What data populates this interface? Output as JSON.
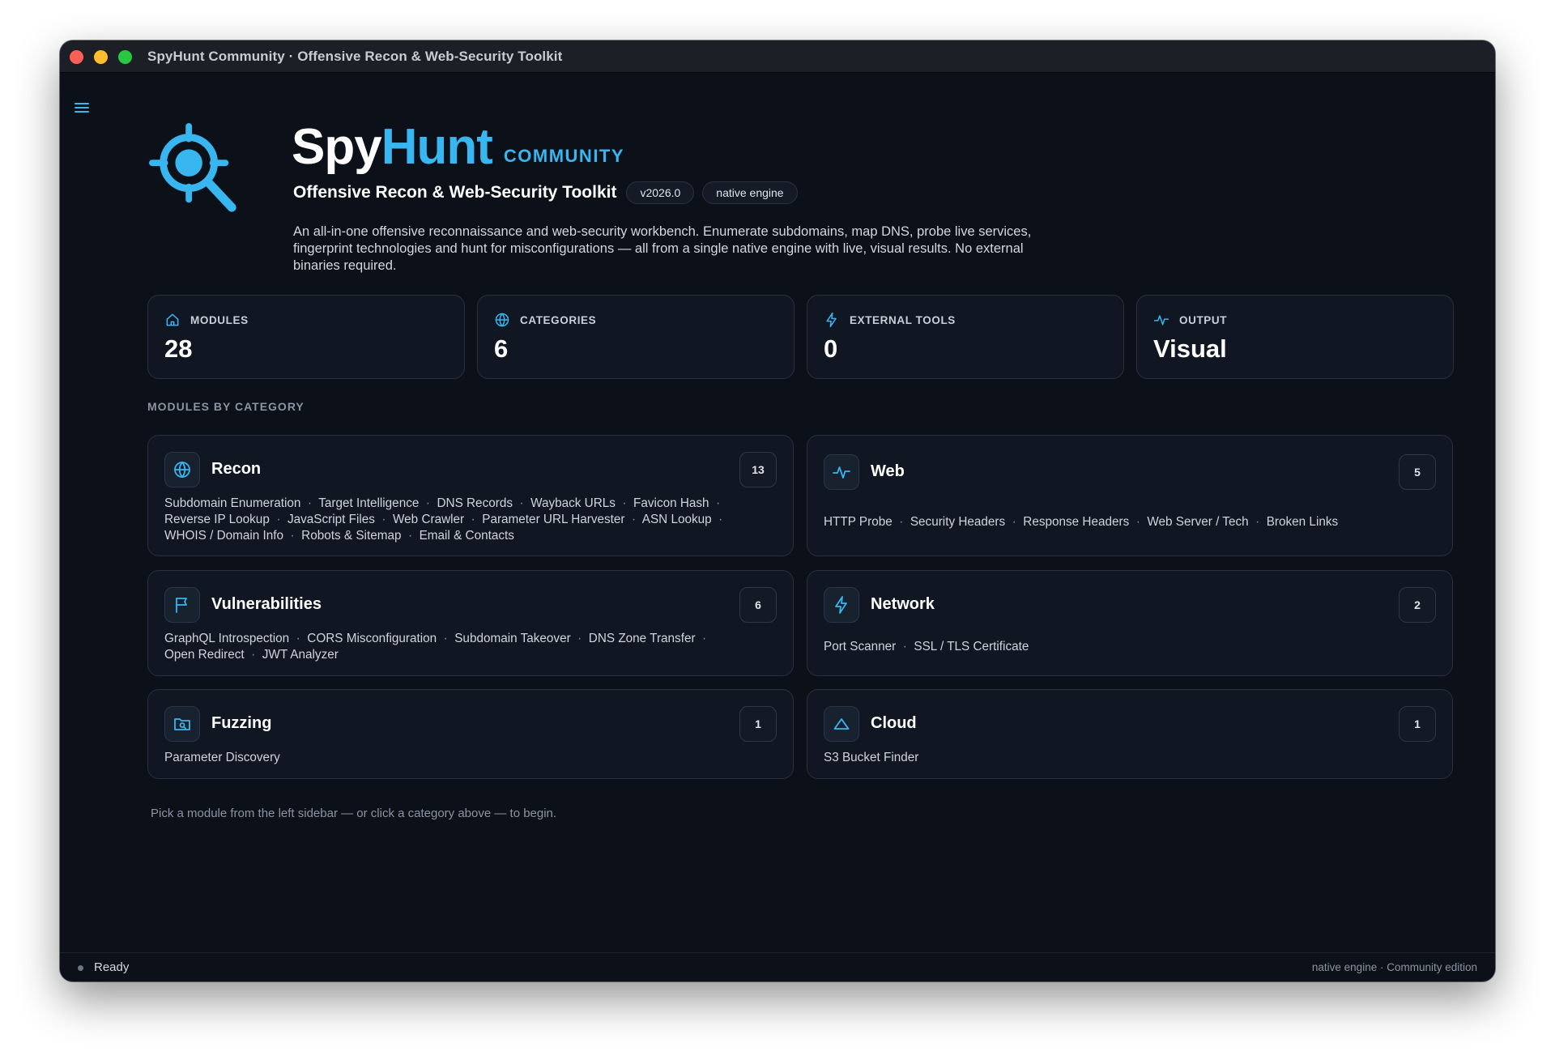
{
  "window": {
    "title": "SpyHunt Community · Offensive Recon & Web-Security Toolkit"
  },
  "header": {
    "brand_part1": "Spy",
    "brand_part2": "Hunt",
    "brand_edition": "COMMUNITY",
    "subtitle": "Offensive Recon & Web-Security Toolkit",
    "version_pill": "v2026.0",
    "engine_pill": "native engine",
    "description": "An all-in-one offensive reconnaissance and web-security workbench. Enumerate subdomains, map DNS, probe live services, fingerprint technologies and hunt for misconfigurations — all from a single native engine with live, visual results. No external binaries required.",
    "logo_icon": "crosshair-magnifier-icon"
  },
  "stats": [
    {
      "label": "MODULES",
      "value": "28",
      "icon": "home-icon"
    },
    {
      "label": "CATEGORIES",
      "value": "6",
      "icon": "globe-icon"
    },
    {
      "label": "EXTERNAL TOOLS",
      "value": "0",
      "icon": "bolt-icon"
    },
    {
      "label": "OUTPUT",
      "value": "Visual",
      "icon": "pulse-icon"
    }
  ],
  "section_label": "MODULES BY CATEGORY",
  "categories": [
    {
      "title": "Recon",
      "count": "13",
      "icon": "globe-icon",
      "modules": [
        "Subdomain Enumeration",
        "Target Intelligence",
        "DNS Records",
        "Wayback URLs",
        "Favicon Hash",
        "Reverse IP Lookup",
        "JavaScript Files",
        "Web Crawler",
        "Parameter URL Harvester",
        "ASN Lookup",
        "WHOIS / Domain Info",
        "Robots & Sitemap",
        "Email & Contacts"
      ]
    },
    {
      "title": "Web",
      "count": "5",
      "icon": "pulse-icon",
      "modules": [
        "HTTP Probe",
        "Security Headers",
        "Response Headers",
        "Web Server / Tech",
        "Broken Links"
      ]
    },
    {
      "title": "Vulnerabilities",
      "count": "6",
      "icon": "flag-icon",
      "modules": [
        "GraphQL Introspection",
        "CORS Misconfiguration",
        "Subdomain Takeover",
        "DNS Zone Transfer",
        "Open Redirect",
        "JWT Analyzer"
      ]
    },
    {
      "title": "Network",
      "count": "2",
      "icon": "bolt-icon",
      "modules": [
        "Port Scanner",
        "SSL / TLS Certificate"
      ]
    },
    {
      "title": "Fuzzing",
      "count": "1",
      "icon": "folder-search-icon",
      "modules": [
        "Parameter Discovery"
      ]
    },
    {
      "title": "Cloud",
      "count": "1",
      "icon": "cloud-triangle-icon",
      "modules": [
        "S3 Bucket Finder"
      ]
    }
  ],
  "hint": "Pick a module from the left sidebar — or click a category above — to begin.",
  "status": {
    "text": "Ready",
    "right": "native engine · Community edition"
  },
  "colors": {
    "accent": "#38b6f0",
    "background": "#0b1019",
    "card": "#111722",
    "border": "#283041"
  }
}
